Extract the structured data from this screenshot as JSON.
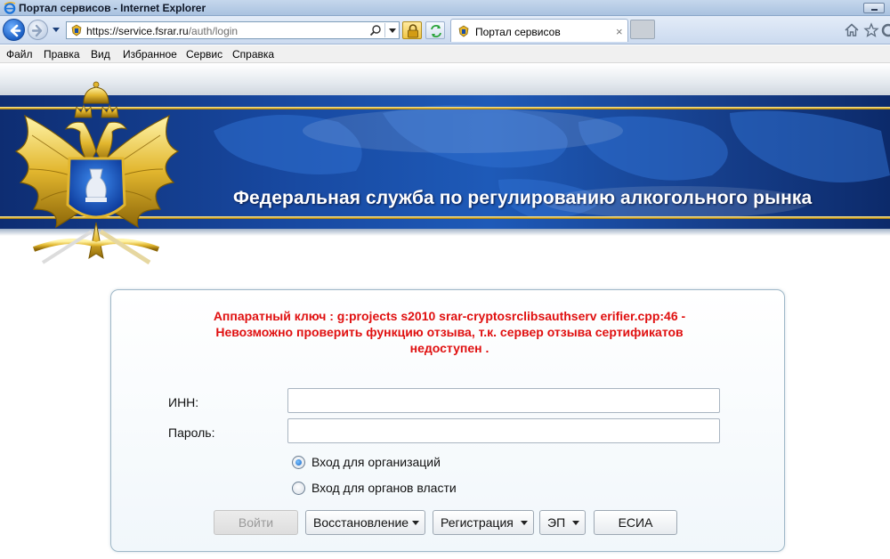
{
  "window": {
    "title": "Портал сервисов - Internet Explorer"
  },
  "browser": {
    "address_secure": "https://",
    "address_host": "service.fsrar.ru",
    "address_path": "/auth/login",
    "tab_label": "Портал сервисов",
    "tab_close": "×"
  },
  "menu": {
    "items": [
      "Файл",
      "Правка",
      "Вид",
      "Избранное",
      "Сервис",
      "Справка"
    ]
  },
  "banner": {
    "title": "Федеральная служба по регулированию алкогольного рынка"
  },
  "login": {
    "error_line1": "Аппаратный ключ : g:projects s2010 srar-cryptosrclibsauthserv erifier.cpp:46 -",
    "error_line2": "Невозможно проверить функцию отзыва, т.к. сервер отзыва сертификатов",
    "error_line3": "недоступен .",
    "inn_label": "ИНН:",
    "inn_value": "",
    "password_label": "Пароль:",
    "password_value": "",
    "radio_org_label": "Вход для организаций",
    "radio_org_selected": true,
    "radio_gov_label": "Вход для органов власти",
    "radio_gov_selected": false,
    "buttons": {
      "login": "Войти",
      "recovery": "Восстановление",
      "registration": "Регистрация",
      "ep": "ЭП",
      "esia": "ЕСИА"
    }
  },
  "colors": {
    "error_text": "#e01010",
    "banner_blue": "#1e5ab8",
    "gold_accent": "#e0b534"
  }
}
